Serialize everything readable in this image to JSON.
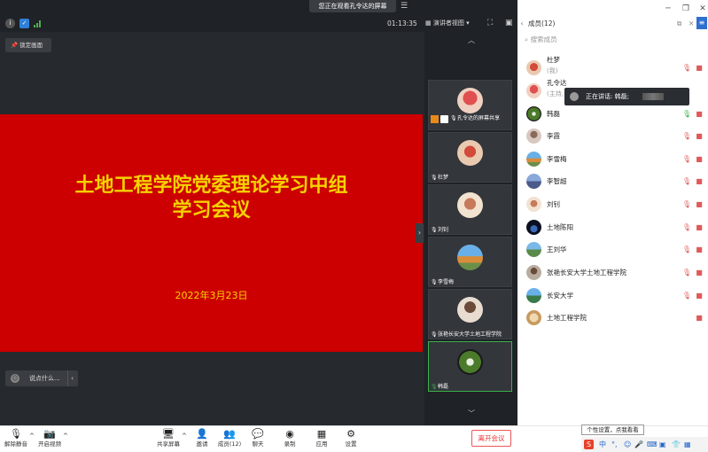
{
  "window": {
    "banner": "您正在观看孔令达的屏幕",
    "timer": "01:13:35",
    "view_mode": "演讲者视图"
  },
  "main": {
    "lock_screen": "锁定画面",
    "slide_title_line1": "土地工程学院党委理论学习中组",
    "slide_title_line2": "学习会议",
    "slide_date": "2022年3月23日",
    "chat_placeholder": "说点什么..."
  },
  "strip": {
    "tiles": [
      {
        "name": "孔令达的屏幕共享"
      },
      {
        "name": "杜梦"
      },
      {
        "name": "刘钊"
      },
      {
        "name": "李雪梅"
      },
      {
        "name": "张艳长安大学土地工程学院"
      },
      {
        "name": "韩磊"
      }
    ]
  },
  "panel": {
    "title": "成员(12)",
    "search_placeholder": "搜索成员",
    "speaking": "正在讲话: 韩磊;",
    "members": [
      {
        "name": "杜梦",
        "sub": "(我)"
      },
      {
        "name": "孔令达",
        "sub": "(主持,"
      },
      {
        "name": "韩磊"
      },
      {
        "name": "李霞"
      },
      {
        "name": "李雪梅"
      },
      {
        "name": "李智超"
      },
      {
        "name": "刘钊"
      },
      {
        "name": "土地陈阳"
      },
      {
        "name": "王刘华"
      },
      {
        "name": "张艳长安大学土地工程学院"
      },
      {
        "name": "长安大学"
      },
      {
        "name": "土地工程学院"
      }
    ]
  },
  "toolbar": {
    "unmute": "解除静音",
    "start_video": "开启视频",
    "share": "共享屏幕",
    "invite": "邀请",
    "members": "成员(12)",
    "chat": "聊天",
    "record": "录制",
    "apps": "应用",
    "settings": "设置",
    "leave": "离开会议"
  },
  "ime": {
    "tooltip": "个性设置，点我看看",
    "lang": "中"
  }
}
